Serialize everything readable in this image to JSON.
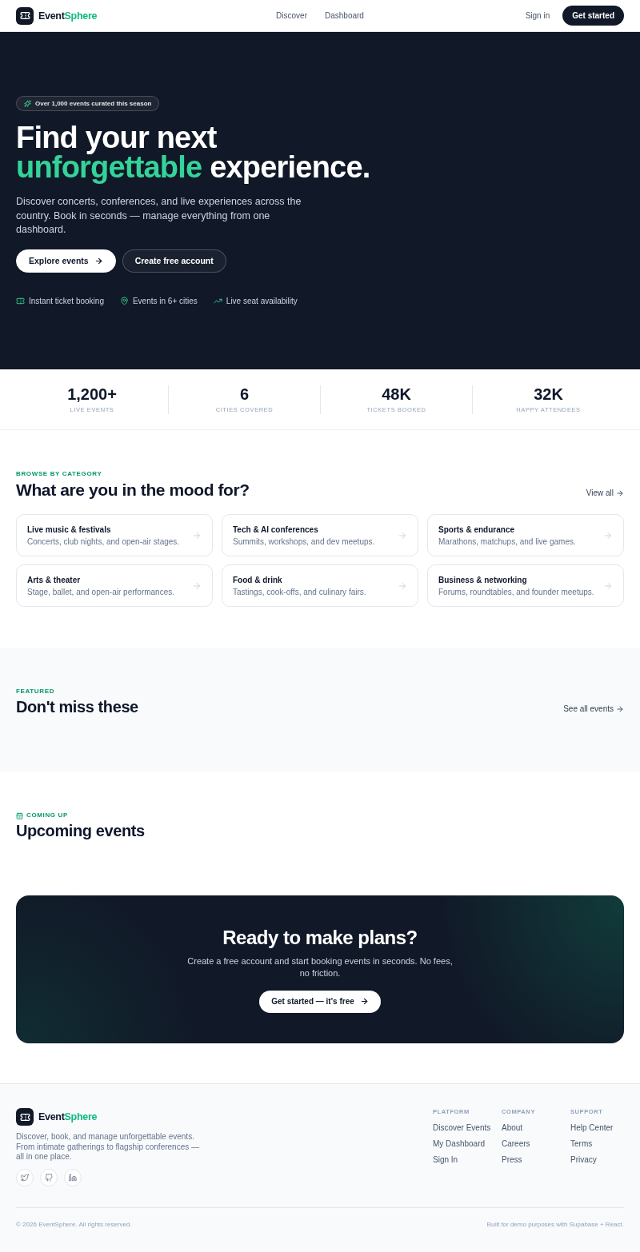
{
  "header": {
    "logo": {
      "text": "Event",
      "accent": "Sphere"
    },
    "nav": [
      "Discover",
      "Dashboard"
    ],
    "sign_in": "Sign in",
    "cta": "Get started"
  },
  "hero": {
    "badge": "Over 1,000 events curated this season",
    "headline": {
      "line1": "Find your next",
      "accent": "unforgettable",
      "rest": "experience."
    },
    "description": "Discover concerts, conferences, and live experiences across the country. Book in seconds — manage everything from one dashboard.",
    "buttons": [
      {
        "label": "Explore events",
        "kind": "primary"
      },
      {
        "label": "Create free account",
        "kind": "secondary"
      }
    ],
    "features": [
      "Instant ticket booking",
      "Events in 6+ cities",
      "Live seat availability"
    ]
  },
  "stats": [
    {
      "value": "1,200+",
      "label": "LIVE EVENTS"
    },
    {
      "value": "6",
      "label": "CITIES COVERED"
    },
    {
      "value": "48K",
      "label": "TICKETS BOOKED"
    },
    {
      "value": "32K",
      "label": "HAPPY ATTENDEES"
    }
  ],
  "categories": {
    "eyebrow": "BROWSE BY CATEGORY",
    "title": "What are you in the mood for?",
    "link": "View all",
    "items": [
      {
        "title": "Live music & festivals",
        "description": "Concerts, club nights, and open-air stages."
      },
      {
        "title": "Tech & AI conferences",
        "description": "Summits, workshops, and dev meetups."
      },
      {
        "title": "Sports & endurance",
        "description": "Marathons, matchups, and live games."
      },
      {
        "title": "Arts & theater",
        "description": "Stage, ballet, and open-air performances."
      },
      {
        "title": "Food & drink",
        "description": "Tastings, cook-offs, and culinary fairs."
      },
      {
        "title": "Business & networking",
        "description": "Forums, roundtables, and founder meetups."
      }
    ]
  },
  "featured": {
    "eyebrow": "FEATURED",
    "title": "Don't miss these",
    "link": "See all events"
  },
  "upcoming": {
    "eyebrow": "COMING UP",
    "title": "Upcoming events"
  },
  "cta": {
    "title": "Ready to make plans?",
    "text": "Create a free account and start booking events in seconds. No fees, no friction.",
    "button": "Get started — it's free"
  },
  "footer": {
    "logo": {
      "text": "Event",
      "accent": "Sphere"
    },
    "description": "Discover, book, and manage unforgettable events. From intimate gatherings to flagship conferences — all in one place.",
    "columns": [
      {
        "heading": "PLATFORM",
        "links": [
          "Discover Events",
          "My Dashboard",
          "Sign In"
        ]
      },
      {
        "heading": "COMPANY",
        "links": [
          "About",
          "Careers",
          "Press"
        ]
      },
      {
        "heading": "SUPPORT",
        "links": [
          "Help Center",
          "Terms",
          "Privacy"
        ]
      }
    ],
    "copyright": "© 2026 EventSphere. All rights reserved.",
    "credit": "Built for demo purposes with Supabase + React."
  }
}
